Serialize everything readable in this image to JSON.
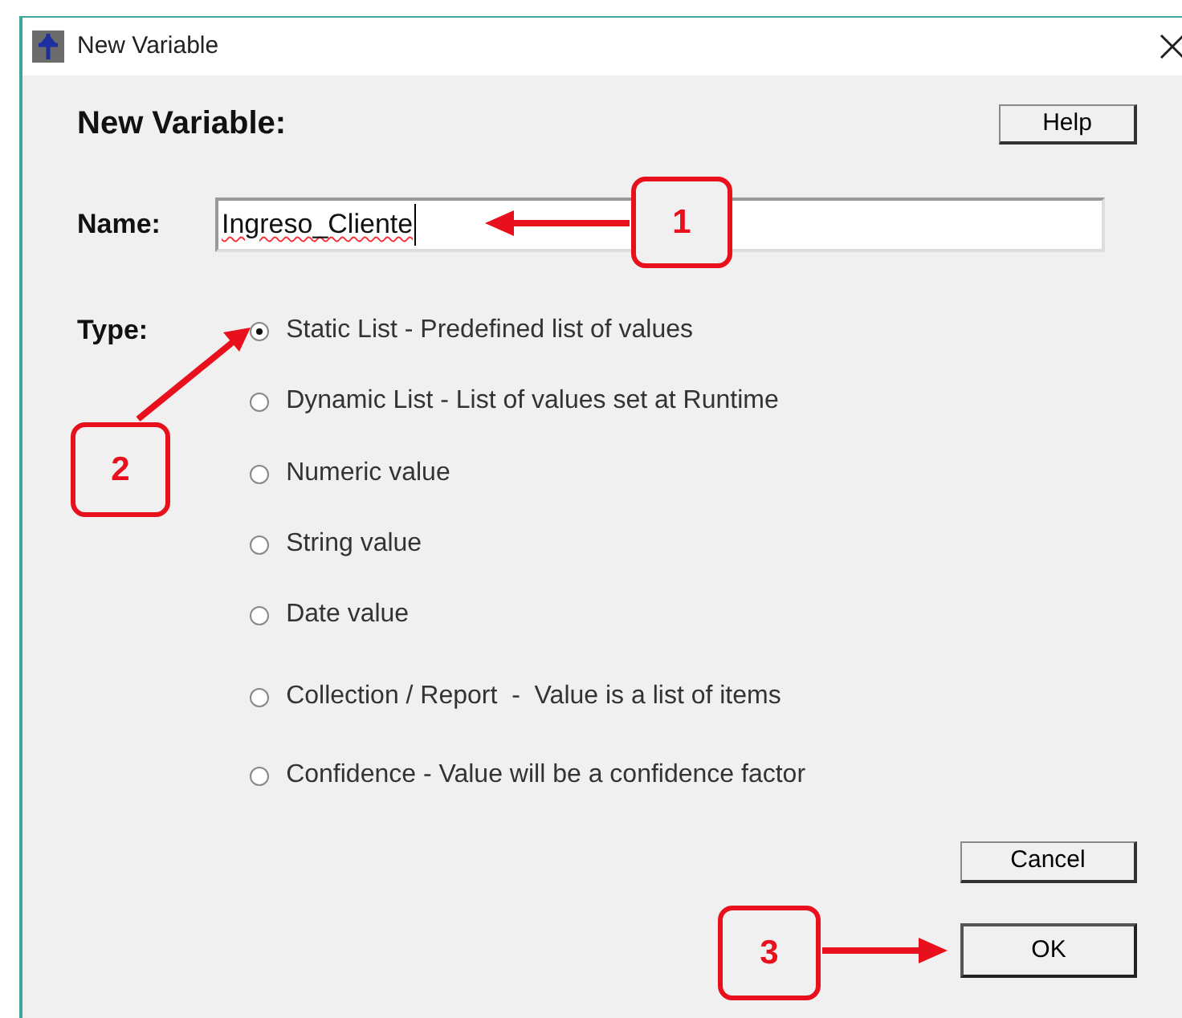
{
  "window": {
    "title": "New Variable"
  },
  "heading": "New Variable:",
  "help_button": "Help",
  "name": {
    "label": "Name:",
    "value": "Ingreso_Cliente"
  },
  "type": {
    "label": "Type:",
    "options": [
      {
        "label": "Static List - Predefined list of values",
        "selected": true
      },
      {
        "label": "Dynamic List - List of values set at Runtime",
        "selected": false
      },
      {
        "label": "Numeric value",
        "selected": false
      },
      {
        "label": "String value",
        "selected": false
      },
      {
        "label": "Date value",
        "selected": false
      },
      {
        "label": "Collection / Report  -  Value is a list of items",
        "selected": false
      },
      {
        "label": "Confidence - Value will be a confidence factor",
        "selected": false
      }
    ]
  },
  "buttons": {
    "cancel": "Cancel",
    "ok": "OK"
  },
  "callouts": [
    {
      "label": "1"
    },
    {
      "label": "2"
    },
    {
      "label": "3"
    }
  ]
}
